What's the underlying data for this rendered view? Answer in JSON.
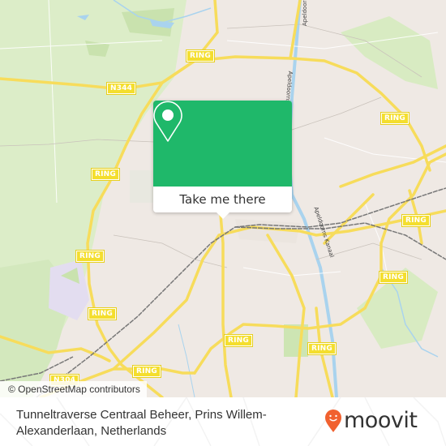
{
  "map": {
    "road_labels": [
      {
        "text": "RING"
      },
      {
        "text": "N344"
      },
      {
        "text": "RING"
      },
      {
        "text": "RING"
      },
      {
        "text": "RING"
      },
      {
        "text": "RING"
      },
      {
        "text": "RING"
      },
      {
        "text": "RING"
      },
      {
        "text": "RING"
      },
      {
        "text": "RING"
      },
      {
        "text": "RING"
      },
      {
        "text": "N304"
      },
      {
        "text": "RING"
      }
    ],
    "canal_labels": [
      "Apeldoorns Kanaal",
      "Apeldoorns Kanaal",
      "Apeldoorns Kanaal"
    ],
    "attribution": "© OpenStreetMap contributors",
    "colors": {
      "background": "#efe9e4",
      "park": "#d8ebc2",
      "road": "#f7e07a",
      "water": "#a9d3ee",
      "rail": "#777777"
    }
  },
  "popup": {
    "icon": "location-pin-icon",
    "button_label": "Take me there",
    "color": "#1fb86a"
  },
  "footer": {
    "address": "Tunneltraverse Centraal Beheer, Prins Willem-Alexanderlaan, Netherlands",
    "brand": "moovit",
    "brand_color": "#f1612f"
  }
}
